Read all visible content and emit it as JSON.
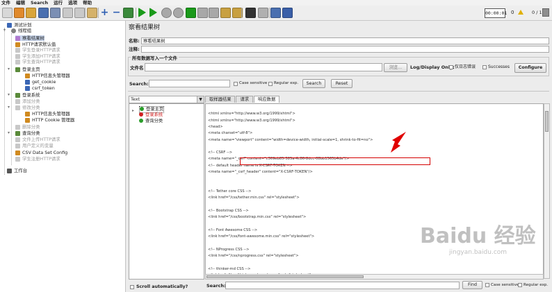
{
  "menu": [
    "文件",
    "编辑",
    "Search",
    "运行",
    "选项",
    "帮助"
  ],
  "toolbar": {
    "icons": [
      "new-icon",
      "templates-icon",
      "open-icon",
      "save-icon",
      "save-as-icon",
      "cut-icon",
      "copy-icon",
      "paste-icon",
      "expand-icon",
      "collapse-icon",
      "toggle-icon",
      "start-icon",
      "start-no-pauses-icon",
      "stop-icon",
      "shutdown-icon",
      "remote-start-icon",
      "remote-stop-icon",
      "remote-shutdown-icon",
      "clear-icon",
      "clear-all-icon",
      "search-icon",
      "reset-search-icon",
      "function-helper-icon",
      "help-icon"
    ],
    "timer": "00:00:01",
    "warnings": "0",
    "threads": "0 / 1"
  },
  "tree": [
    {
      "label": "测试计划",
      "level": 0,
      "icon": "test-plan-icon",
      "disabled": false
    },
    {
      "label": "线程组",
      "level": 1,
      "icon": "thread-group-icon",
      "disabled": false
    },
    {
      "label": "察看结果树",
      "level": 2,
      "icon": "listener-icon",
      "disabled": false,
      "selected": true
    },
    {
      "label": "HTTP请求默认值",
      "level": 2,
      "icon": "config-icon",
      "disabled": false
    },
    {
      "label": "学生登录HTTP请求",
      "level": 2,
      "icon": "sampler-icon",
      "disabled": true
    },
    {
      "label": "学生添加HTTP请求",
      "level": 2,
      "icon": "sampler-icon",
      "disabled": true
    },
    {
      "label": "学生查询HTTP请求",
      "level": 2,
      "icon": "sampler-icon",
      "disabled": true
    },
    {
      "label": "登录主页",
      "level": 2,
      "icon": "sampler-icon",
      "disabled": false
    },
    {
      "label": "HTTP信息头管理器",
      "level": 3,
      "icon": "config-icon",
      "disabled": false
    },
    {
      "label": "get_cookie",
      "level": 3,
      "icon": "extractor-icon",
      "disabled": false
    },
    {
      "label": "csrf_token",
      "level": 3,
      "icon": "extractor-icon",
      "disabled": false
    },
    {
      "label": "登录系统",
      "level": 2,
      "icon": "sampler-icon",
      "disabled": false
    },
    {
      "label": "添加分类",
      "level": 2,
      "icon": "sampler-icon",
      "disabled": true
    },
    {
      "label": "修改分类",
      "level": 2,
      "icon": "sampler-icon",
      "disabled": true
    },
    {
      "label": "HTTP信息头管理器",
      "level": 3,
      "icon": "config-icon",
      "disabled": false
    },
    {
      "label": "HTTP Cookie 管理器",
      "level": 3,
      "icon": "config-icon",
      "disabled": false
    },
    {
      "label": "删除分类",
      "level": 2,
      "icon": "sampler-icon",
      "disabled": true
    },
    {
      "label": "查询分类",
      "level": 2,
      "icon": "sampler-icon",
      "disabled": false
    },
    {
      "label": "文件上传HTTP请求",
      "level": 2,
      "icon": "sampler-icon",
      "disabled": true
    },
    {
      "label": "用户定义的变量",
      "level": 2,
      "icon": "config-icon",
      "disabled": true
    },
    {
      "label": "CSV Data Set Config",
      "level": 2,
      "icon": "config-icon",
      "disabled": false
    },
    {
      "label": "学生注册HTTP请求",
      "level": 2,
      "icon": "sampler-icon",
      "disabled": true
    },
    {
      "label": "工作台",
      "level": 0,
      "icon": "workbench-icon",
      "disabled": false
    }
  ],
  "panel": {
    "title": "察看结果树",
    "name_label": "名称:",
    "name_value": "察看结果树",
    "comment_label": "注释:",
    "comment_value": "",
    "file_group_label": "所有数据写入一个文件",
    "filename_label": "文件名",
    "filename_value": "",
    "browse_label": "浏览...",
    "log_display_label": "Log/Display Only:",
    "errors_label": "仅日志错误",
    "successes_label": "Successes",
    "configure_label": "Configure",
    "search_label": "Search:",
    "search_value": "",
    "case_sensitive_label": "Case sensitive",
    "regex_label": "Regular exp.",
    "search_button": "Search",
    "reset_button": "Reset"
  },
  "results": {
    "renderer": "Text",
    "samples": [
      {
        "label": "登录主页",
        "status": "success",
        "selected": true
      },
      {
        "label": "登录系统",
        "status": "error",
        "selected": false
      },
      {
        "label": "查询分类",
        "status": "success",
        "selected": false
      }
    ],
    "scroll_auto_label": "Scroll automatically?",
    "tabs": [
      {
        "label": "取样器结果",
        "active": false
      },
      {
        "label": "请求",
        "active": false
      },
      {
        "label": "响应数据",
        "active": true
      }
    ],
    "response_lines": [
      "",
      "<html xmlns=\"http://www.w3.org/1999/xhtml\">",
      "<html xmlns=\"http://www.w3.org/1999/xhtml\">",
      "<head>",
      "  <meta charset=\"utf-8\">",
      "  <meta name=\"viewport\" content=\"width=device-width, initial-scale=1, shrink-to-fit=no\">",
      "",
      "  <!-- CSRF -->",
      "       <meta name=\"_csrf\" content=\"c369eb85-585a-4c86-8dcc-08bb1565b4de\"/>",
      "       <!-- default header name is X-CSRF-TOKEN -->",
      "       <meta name=\"_csrf_header\" content=\"X-CSRF-TOKEN\"/>",
      "",
      "",
      "  <!-- Tether core CSS -->",
      "  <link href=\"/css/tether.min.css\" rel=\"stylesheet\">",
      "",
      "  <!-- Bootstrap CSS -->",
      "  <link href=\"/css/bootstrap.min.css\" rel=\"stylesheet\">",
      "",
      "  <!-- Font Awesome CSS -->",
      "  <link href=\"/css/font-awesome.min.css\" rel=\"stylesheet\">",
      "",
      "  <!-- NProgress CSS -->",
      "  <link href=\"/css/nprogress.css\" rel=\"stylesheet\">",
      "",
      "  <!-- thinker-md CSS -->",
      "  <link href=\"/css/thinker-md.vendor.css\" rel=\"stylesheet\">"
    ],
    "bottom_search_label": "Search:",
    "bottom_search_value": "",
    "find_button": "Find",
    "bottom_case_label": "Case sensitive",
    "bottom_regex_label": "Regular exp."
  },
  "watermark": "Baidu 经验",
  "watermark_sub": "jingyan.baidu.com",
  "colors": {
    "highlight_box": "#d40000",
    "arrow": "#e00000",
    "success": "#2a9d2a",
    "error": "#d02020"
  }
}
